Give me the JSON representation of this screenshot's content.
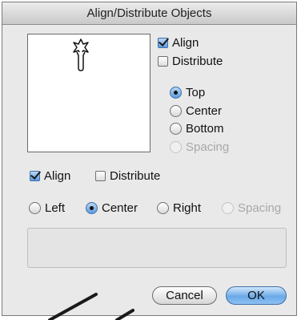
{
  "dialog": {
    "title": "Align/Distribute Objects"
  },
  "vertical": {
    "align_label": "Align",
    "align_checked": true,
    "distribute_label": "Distribute",
    "distribute_checked": false,
    "options": [
      {
        "label": "Top",
        "selected": true,
        "enabled": true
      },
      {
        "label": "Center",
        "selected": false,
        "enabled": true
      },
      {
        "label": "Bottom",
        "selected": false,
        "enabled": true
      },
      {
        "label": "Spacing",
        "selected": false,
        "enabled": false
      }
    ]
  },
  "horizontal": {
    "align_label": "Align",
    "align_checked": true,
    "distribute_label": "Distribute",
    "distribute_checked": false,
    "options": [
      {
        "label": "Left",
        "selected": false,
        "enabled": true
      },
      {
        "label": "Center",
        "selected": true,
        "enabled": true
      },
      {
        "label": "Right",
        "selected": false,
        "enabled": true
      },
      {
        "label": "Spacing",
        "selected": false,
        "enabled": false
      }
    ]
  },
  "buttons": {
    "cancel": "Cancel",
    "ok": "OK"
  },
  "icons": {
    "preview": "tee-icon"
  },
  "colors": {
    "accent": "#5d9be0",
    "ok_button": "#6aaae9"
  }
}
